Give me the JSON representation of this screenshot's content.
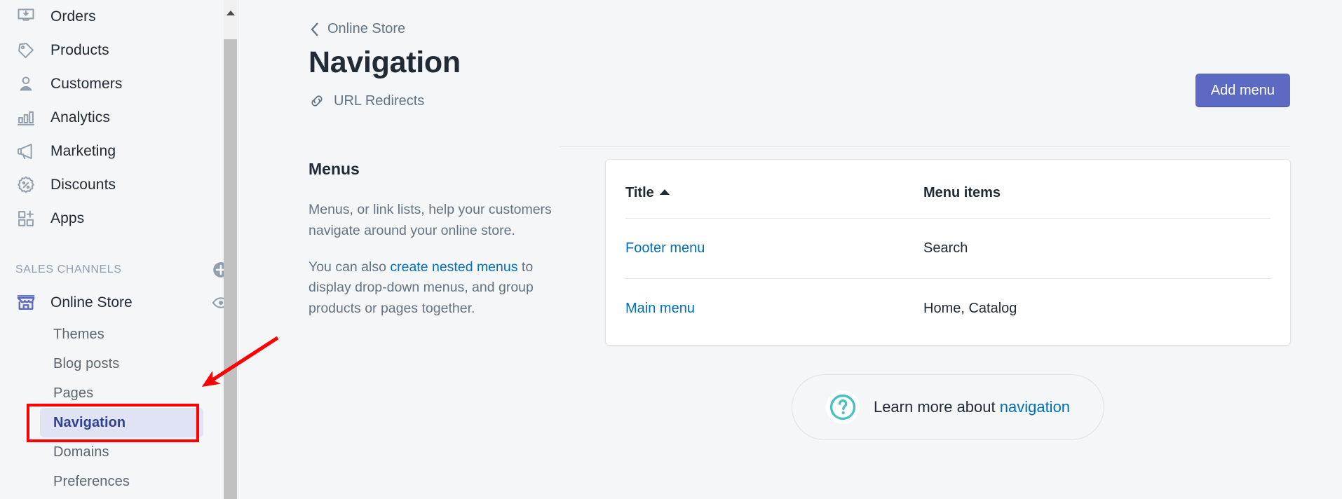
{
  "sidebar": {
    "primary_items": [
      {
        "label": "Orders",
        "icon": "orders-inbox-icon"
      },
      {
        "label": "Products",
        "icon": "products-tag-icon"
      },
      {
        "label": "Customers",
        "icon": "customers-person-icon"
      },
      {
        "label": "Analytics",
        "icon": "analytics-bar-chart-icon"
      },
      {
        "label": "Marketing",
        "icon": "marketing-megaphone-icon"
      },
      {
        "label": "Discounts",
        "icon": "discounts-percent-badge-icon"
      },
      {
        "label": "Apps",
        "icon": "apps-grid-plus-icon"
      }
    ],
    "sales_channels": {
      "section_title": "SALES CHANNELS",
      "add_icon": "circle-plus-icon",
      "channel": {
        "label": "Online Store",
        "icon": "storefront-icon",
        "view_icon": "eye-icon"
      },
      "sub_items": [
        {
          "label": "Themes",
          "active": false
        },
        {
          "label": "Blog posts",
          "active": false
        },
        {
          "label": "Pages",
          "active": false
        },
        {
          "label": "Navigation",
          "active": true
        },
        {
          "label": "Domains",
          "active": false
        },
        {
          "label": "Preferences",
          "active": false
        }
      ]
    },
    "scrollbar": {
      "up_arrow_icon": "scroll-up-arrow-icon"
    }
  },
  "header": {
    "breadcrumb": {
      "label": "Online Store",
      "icon": "chevron-left-icon"
    },
    "title": "Navigation",
    "subnav": {
      "label": "URL Redirects",
      "icon": "link-chain-icon"
    },
    "add_menu_label": "Add menu"
  },
  "menus_section": {
    "heading": "Menus",
    "paragraph_1": "Menus, or link lists, help your customers navigate around your online store.",
    "paragraph_2_before": "You can also ",
    "paragraph_2_link": "create nested menus",
    "paragraph_2_after": " to display drop-down menus, and group products or pages together."
  },
  "table": {
    "columns": [
      {
        "label": "Title",
        "sorted": true,
        "sort_direction": "asc"
      },
      {
        "label": "Menu items",
        "sorted": false
      }
    ],
    "rows": [
      {
        "title": "Footer menu",
        "menu_items": "Search"
      },
      {
        "title": "Main menu",
        "menu_items": "Home, Catalog"
      }
    ]
  },
  "help_banner": {
    "icon": "question-circle-icon",
    "text_before": "Learn more about ",
    "link": "navigation"
  },
  "annotations": {
    "highlight_rect_color": "#ff0000",
    "arrow_color": "#ff0000"
  },
  "colors": {
    "brand_purple": "#5c6ac4",
    "link_blue": "#006fbb",
    "active_nav_bg": "#dfe3f3",
    "active_nav_text": "#31418f",
    "page_bg": "#f4f6f8",
    "text_primary": "#212b36",
    "text_subdued": "#637381",
    "help_teal": "#47c1bf"
  }
}
